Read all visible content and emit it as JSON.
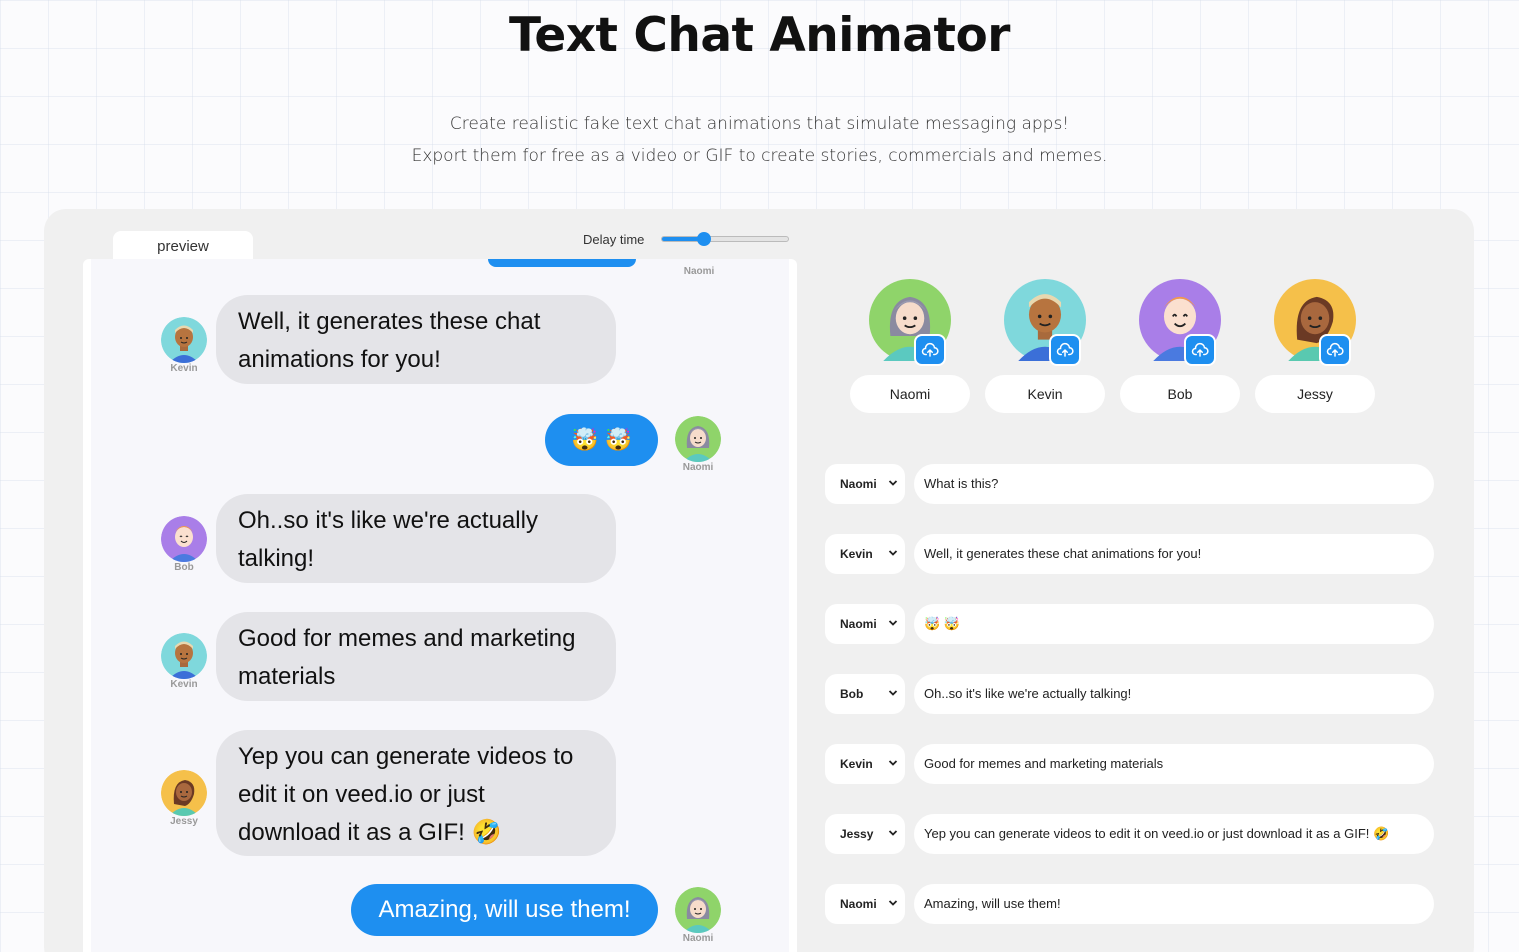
{
  "title": "Text Chat Animator",
  "subtitle": {
    "line1": "Create realistic fake text chat animations that simulate messaging apps!",
    "line2": "Export them for free as a video or GIF to create stories, commercials and memes."
  },
  "preview_tab": "preview",
  "delay": {
    "label": "Delay time",
    "value_fraction": 0.33
  },
  "preview": {
    "top_name": "Naomi",
    "messages": [
      {
        "sender": "Kevin",
        "text": "Well, it generates these chat animations for you!"
      },
      {
        "sender": "Naomi",
        "text": "🤯 🤯"
      },
      {
        "sender": "Bob",
        "text": "Oh..so it's like we're actually talking!"
      },
      {
        "sender": "Kevin",
        "text": "Good for memes and marketing materials"
      },
      {
        "sender": "Jessy",
        "text": "Yep you can generate videos to edit it on veed.io or just download it as a GIF! 🤣"
      },
      {
        "sender": "Naomi",
        "text": "Amazing, will use them!"
      }
    ]
  },
  "characters": [
    {
      "name": "Naomi"
    },
    {
      "name": "Kevin"
    },
    {
      "name": "Bob"
    },
    {
      "name": "Jessy"
    }
  ],
  "rows": [
    {
      "sender": "Naomi",
      "text": "What is this?"
    },
    {
      "sender": "Kevin",
      "text": "Well, it generates these chat animations for you!"
    },
    {
      "sender": "Naomi",
      "text": "🤯 🤯"
    },
    {
      "sender": "Bob",
      "text": "Oh..so it's like we're actually talking!"
    },
    {
      "sender": "Kevin",
      "text": "Good for memes and marketing materials"
    },
    {
      "sender": "Jessy",
      "text": "Yep you can generate videos to edit it on veed.io or just download it as a GIF! 🤣"
    },
    {
      "sender": "Naomi",
      "text": "Amazing, will use them!"
    }
  ],
  "colors": {
    "accent": "#1e8ff0",
    "incoming_bubble": "#e4e4e8",
    "naomi_bg": "#8fd46a",
    "kevin_bg": "#7fd8dc",
    "bob_bg": "#a97ee8",
    "jessy_bg": "#f5c04a"
  },
  "icons": {
    "upload": "cloud-upload-icon",
    "select": "chevron-down-icon"
  }
}
